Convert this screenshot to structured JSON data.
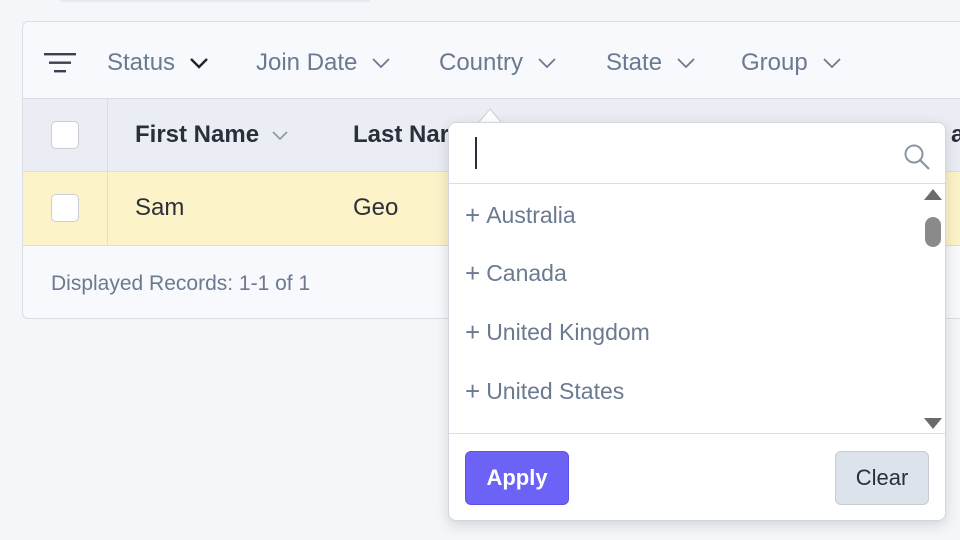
{
  "filters": [
    {
      "label": "Status"
    },
    {
      "label": "Join Date"
    },
    {
      "label": "Country"
    },
    {
      "label": "State"
    },
    {
      "label": "Group"
    }
  ],
  "table": {
    "columns": [
      "First Name",
      "Last Nar",
      "ar"
    ],
    "rows": [
      {
        "first_name": "Sam",
        "last_name": "Geo"
      }
    ],
    "footer": "Displayed Records: 1-1 of 1"
  },
  "country_popover": {
    "search_value": "",
    "options": [
      {
        "label": "Australia"
      },
      {
        "label": "Canada"
      },
      {
        "label": "United Kingdom"
      },
      {
        "label": "United States"
      }
    ],
    "plus_symbol": "+",
    "apply_label": "Apply",
    "clear_label": "Clear"
  },
  "colors": {
    "accent": "#6c63f6",
    "row_highlight": "#fdf3c9",
    "muted_text": "#6b7a90"
  },
  "icons": [
    "filter-lines-icon",
    "chevron-down-icon",
    "search-icon",
    "plus-icon",
    "scroll-up-arrow-icon",
    "scroll-down-arrow-icon"
  ]
}
